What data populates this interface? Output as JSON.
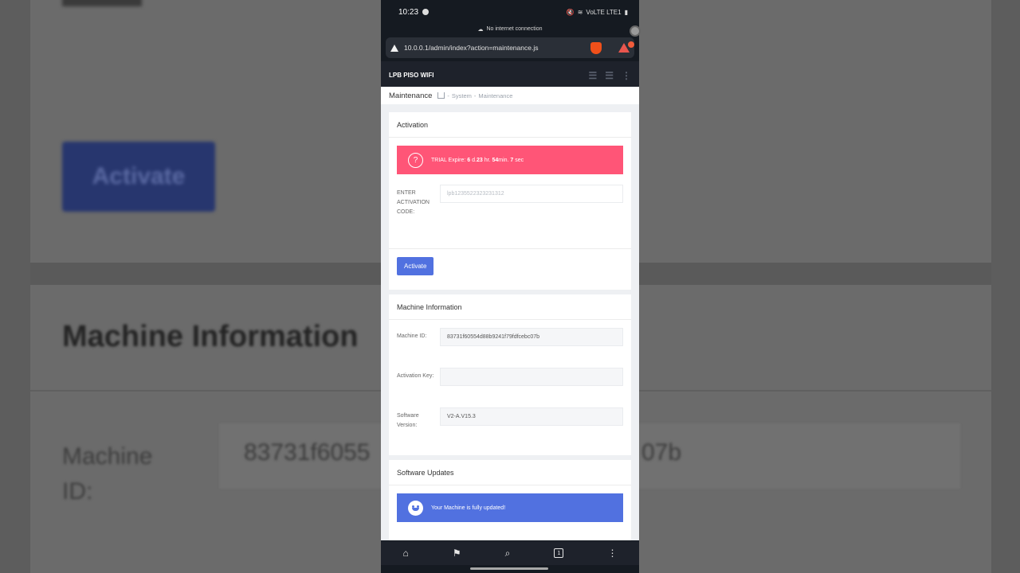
{
  "status": {
    "time": "10:23",
    "network": "VoLTE LTE1",
    "no_internet": "No internet connection"
  },
  "browser": {
    "url": "10.0.0.1/admin/index?action=maintenance.js"
  },
  "app": {
    "brand": "LPB PISO WIFI"
  },
  "breadcrumb": {
    "title": "Maintenance",
    "items": [
      "System",
      "Maintenance"
    ]
  },
  "activation": {
    "title": "Activation",
    "alert": {
      "prefix": "TRIAL Expire: ",
      "d": "6",
      "d_unit": " d.",
      "hr": "23",
      "hr_unit": " hr. ",
      "min": "54",
      "min_unit": "min. ",
      "sec": "7",
      "sec_unit": " sec"
    },
    "code_label": "ENTER ACTIVATION CODE:",
    "code_placeholder": "lpb1235522323231312",
    "button": "Activate"
  },
  "machine": {
    "title": "Machine Information",
    "id_label": "Machine ID:",
    "id_value": "83731f60554d88b9241f79fdfcebc07b",
    "key_label": "Activation Key:",
    "key_value": "",
    "version_label": "Software Version:",
    "version_value": "V2-A.V15.3"
  },
  "updates": {
    "title": "Software Updates",
    "message": "Your Machine is fully updated!"
  },
  "background": {
    "activate": "Activate",
    "title": "Machine Information",
    "label_line1": "Machine",
    "label_line2": "ID:",
    "id_left": "83731f6055",
    "id_right": "07b"
  },
  "nav": {
    "tabs_count": "1"
  },
  "colors": {
    "accent": "#5171e0",
    "danger": "#ff5577",
    "topbar": "#1e222b"
  }
}
